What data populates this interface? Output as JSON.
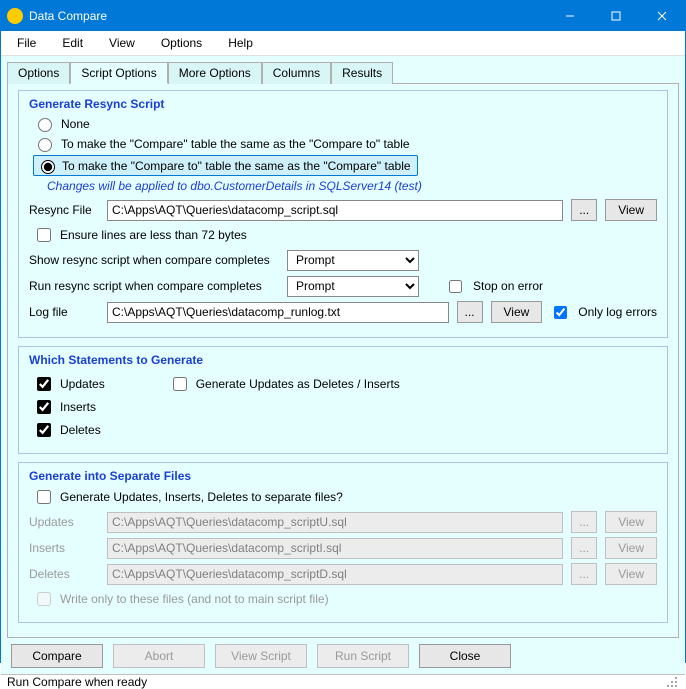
{
  "window": {
    "title": "Data Compare"
  },
  "menu": {
    "file": "File",
    "edit": "Edit",
    "view": "View",
    "options": "Options",
    "help": "Help"
  },
  "tabs": {
    "options": "Options",
    "script_options": "Script Options",
    "more_options": "More Options",
    "columns": "Columns",
    "results": "Results"
  },
  "resync": {
    "group_title": "Generate Resync Script",
    "radio_none": "None",
    "radio_to_compare_to": "To make the \"Compare\" table the same as the \"Compare to\" table",
    "radio_to_compare": "To make the \"Compare to\" table the same as the \"Compare\" table",
    "note": "Changes will be applied to dbo.CustomerDetails in SQLServer14 (test)",
    "resync_file_label": "Resync File",
    "resync_file_value": "C:\\Apps\\AQT\\Queries\\datacomp_script.sql",
    "browse": "...",
    "view": "View",
    "ensure72": "Ensure lines are less than 72 bytes",
    "show_when_label": "Show resync script when compare completes",
    "show_when_value": "Prompt",
    "run_when_label": "Run resync script when compare completes",
    "run_when_value": "Prompt",
    "stop_on_error": "Stop on error",
    "log_file_label": "Log file",
    "log_file_value": "C:\\Apps\\AQT\\Queries\\datacomp_runlog.txt",
    "only_log_errors": "Only log errors"
  },
  "which": {
    "group_title": "Which Statements to Generate",
    "updates": "Updates",
    "inserts": "Inserts",
    "deletes": "Deletes",
    "gen_as_deletes_inserts": "Generate Updates as Deletes / Inserts"
  },
  "sep": {
    "group_title": "Generate into Separate Files",
    "gen_separate": "Generate Updates, Inserts, Deletes to separate files?",
    "updates_label": "Updates",
    "updates_value": "C:\\Apps\\AQT\\Queries\\datacomp_scriptU.sql",
    "inserts_label": "Inserts",
    "inserts_value": "C:\\Apps\\AQT\\Queries\\datacomp_scriptI.sql",
    "deletes_label": "Deletes",
    "deletes_value": "C:\\Apps\\AQT\\Queries\\datacomp_scriptD.sql",
    "write_only": "Write only to these files (and not to main script file)",
    "browse": "...",
    "view": "View"
  },
  "buttons": {
    "compare": "Compare",
    "abort": "Abort",
    "view_script": "View Script",
    "run_script": "Run Script",
    "close": "Close"
  },
  "status": {
    "text": "Run Compare when ready"
  }
}
